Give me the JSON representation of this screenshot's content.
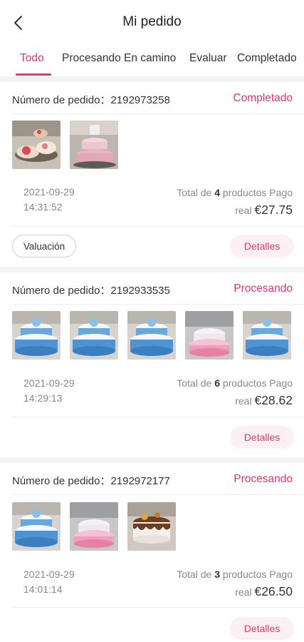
{
  "header": {
    "title": "Mi pedido",
    "back_icon": "back-arrow-icon"
  },
  "tabs": [
    {
      "label": "Todo",
      "active": true
    },
    {
      "label": "Procesando",
      "active": false
    },
    {
      "label": "En camino",
      "active": false
    },
    {
      "label": "Evaluar",
      "active": false
    },
    {
      "label": "Completado",
      "active": false
    }
  ],
  "colors": {
    "accent": "#e5356c",
    "background": "#f3f3f3"
  },
  "orders": [
    {
      "label": "Número de pedido：2192973258",
      "status": "Completado",
      "date": "2021-09-29",
      "time": "14:31:52",
      "total_prefix": "Total de ",
      "count": "4",
      "total_suffix": " productos Pago",
      "real_label": "real ",
      "price": "€27.75",
      "valuation_button": "Valuación",
      "details_button": "Detalles",
      "thumbnails": [
        "cake-stand-photo",
        "cake-tower-photo"
      ]
    },
    {
      "label": "Número de pedido：2192933535",
      "status": "Procesando",
      "date": "2021-09-29",
      "time": "14:29:13",
      "total_prefix": "Total de ",
      "count": "6",
      "total_suffix": " productos Pago",
      "real_label": "real ",
      "price": "€28.62",
      "details_button": "Detalles",
      "thumbnails": [
        "blue-cake-photo",
        "blue-cake-photo",
        "blue-cake-photo",
        "pink-cake-photo",
        "blue-cake-photo"
      ]
    },
    {
      "label": "Número de pedido：2192972177",
      "status": "Procesando",
      "date": "2021-09-29",
      "time": "14:01:14",
      "total_prefix": "Total de ",
      "count": "3",
      "total_suffix": " productos Pago",
      "real_label": "real ",
      "price": "€26.50",
      "details_button": "Detalles",
      "thumbnails": [
        "blue-cake-photo",
        "pink-cake-photo",
        "drip-cake-photo"
      ]
    }
  ]
}
